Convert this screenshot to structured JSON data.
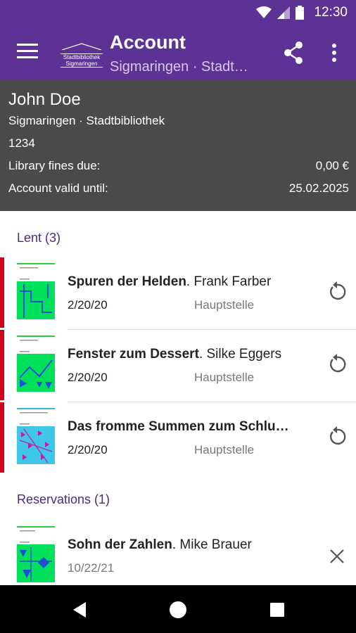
{
  "status_bar": {
    "time": "12:30"
  },
  "app_bar": {
    "title": "Account",
    "subtitle": "Sigmaringen · Stadt…",
    "logo_line1": "Stadtbibliothek",
    "logo_line2": "Sigmaringen"
  },
  "account": {
    "name": "John Doe",
    "library": "Sigmaringen · Stadtbibliothek",
    "card_number": "1234",
    "fines_label": "Library fines due:",
    "fines_value": "0,00 €",
    "valid_label": "Account valid until:",
    "valid_value": "25.02.2025"
  },
  "lent": {
    "header": "Lent (3)",
    "items": [
      {
        "title": "Spuren der Helden",
        "author": ". Frank Farber",
        "date": "2/20/20",
        "branch": "Hauptstelle"
      },
      {
        "title": "Fenster zum Dessert",
        "author": ". Silke Eggers",
        "date": "2/20/20",
        "branch": "Hauptstelle"
      },
      {
        "title": "Das fromme Summen zum Schlu…",
        "author": "",
        "date": "2/20/20",
        "branch": "Hauptstelle"
      }
    ]
  },
  "reservations": {
    "header": "Reservations (1)",
    "items": [
      {
        "title": "Sohn der Zahlen",
        "author": ". Mike Brauer",
        "date": "10/22/21"
      }
    ]
  },
  "colors": {
    "primary": "#5e3294",
    "card": "#4a4a4a",
    "overdue": "#d0021b",
    "section": "#4b2a7e"
  }
}
